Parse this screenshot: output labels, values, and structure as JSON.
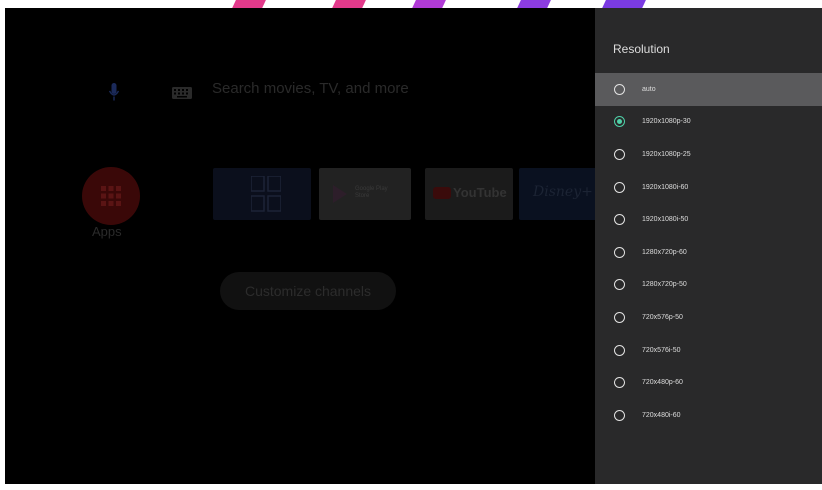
{
  "colors": {
    "panel_bg": "#29292a",
    "focus_bg": "#5a5a5c",
    "selected_radio": "#4fd1a8",
    "top_marks": "#e23a8b"
  },
  "search": {
    "mic_icon": "mic-icon",
    "keyboard_icon": "keyboard-icon",
    "placeholder": "Search movies, TV, and more"
  },
  "apps": {
    "icon": "grid-icon",
    "label": "Apps"
  },
  "tiles": {
    "play": {
      "text": "Google Play Store"
    },
    "youtube": {
      "text": "YouTube"
    },
    "disney": {
      "text": "Disney+"
    }
  },
  "customize_label": "Customize channels",
  "panel": {
    "title": "Resolution",
    "options": [
      {
        "label": "auto",
        "focused": true,
        "selected": false
      },
      {
        "label": "1920x1080p-30",
        "focused": false,
        "selected": true
      },
      {
        "label": "1920x1080p-25",
        "focused": false,
        "selected": false
      },
      {
        "label": "1920x1080i-60",
        "focused": false,
        "selected": false
      },
      {
        "label": "1920x1080i-50",
        "focused": false,
        "selected": false
      },
      {
        "label": "1280x720p-60",
        "focused": false,
        "selected": false
      },
      {
        "label": "1280x720p-50",
        "focused": false,
        "selected": false
      },
      {
        "label": "720x576p-50",
        "focused": false,
        "selected": false
      },
      {
        "label": "720x576i-50",
        "focused": false,
        "selected": false
      },
      {
        "label": "720x480p-60",
        "focused": false,
        "selected": false
      },
      {
        "label": "720x480i-60",
        "focused": false,
        "selected": false
      }
    ]
  }
}
